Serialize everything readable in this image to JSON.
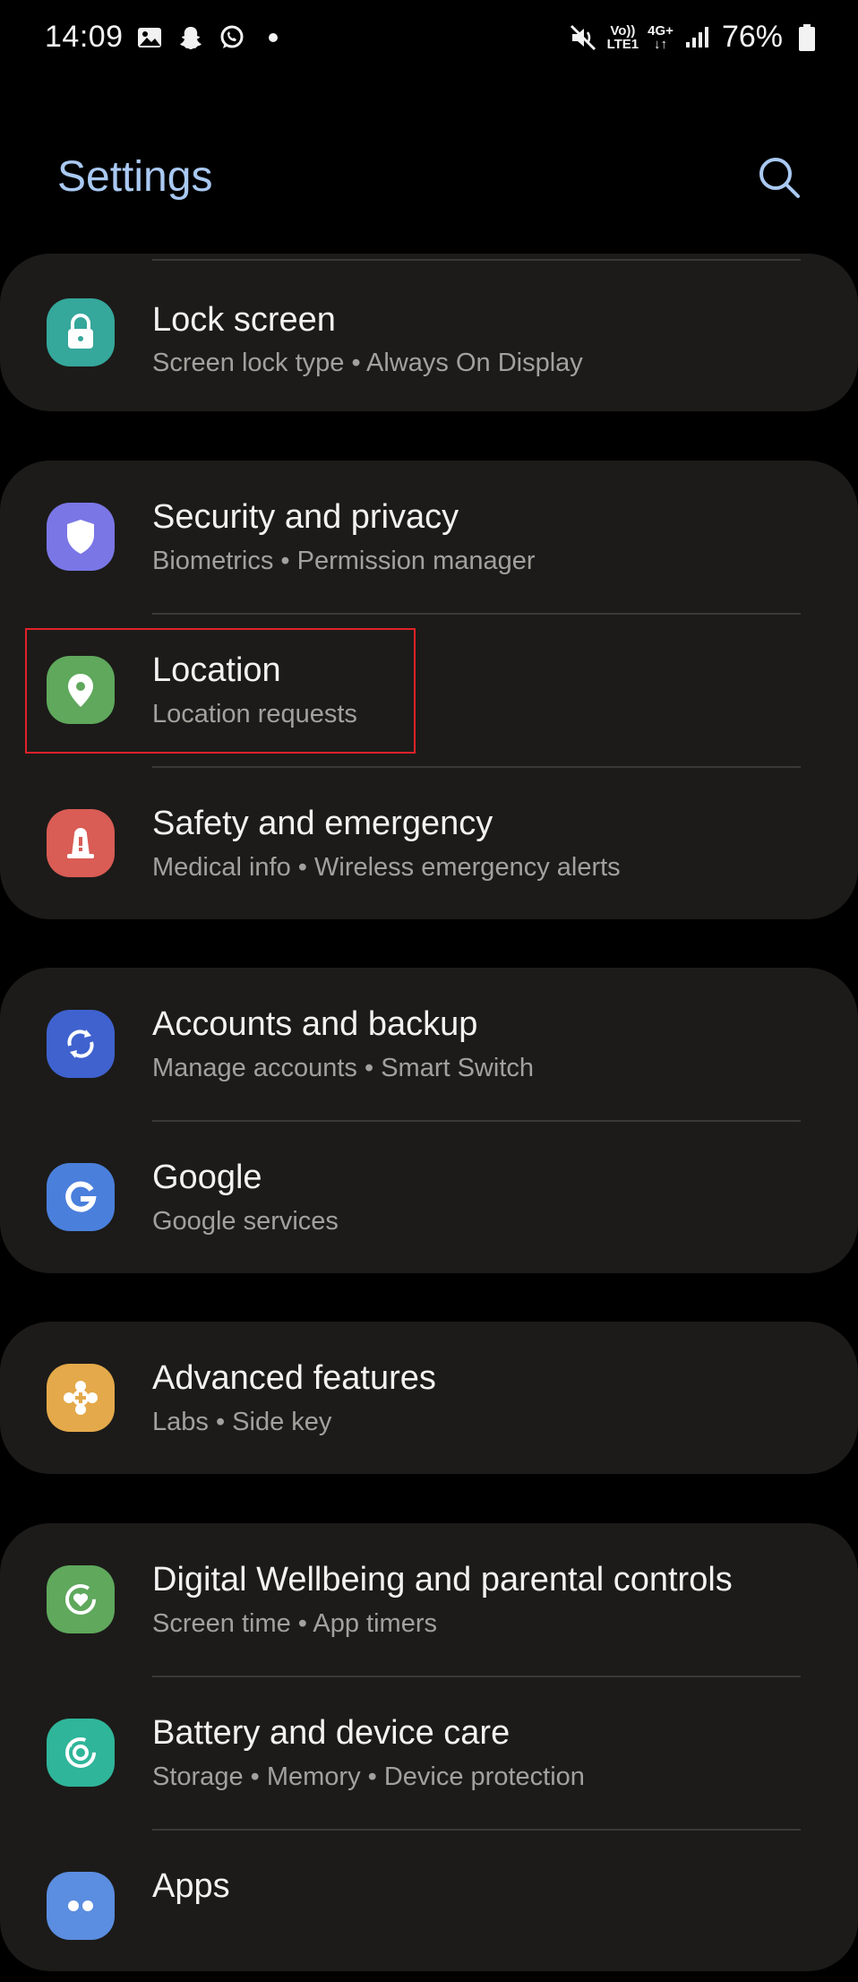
{
  "status_bar": {
    "time": "14:09",
    "notification_icons": [
      "gallery-icon",
      "snapchat-icon",
      "whatsapp-icon",
      "dot-icon"
    ],
    "system_icons": [
      "mute-icon",
      "volte-icon",
      "data-4g-icon",
      "signal-icon",
      "battery-icon"
    ],
    "volte_top": "Vo))",
    "volte_bottom": "LTE1",
    "net_type": "4G+",
    "battery_percent": "76%"
  },
  "header": {
    "title": "Settings",
    "search_icon": "search-icon"
  },
  "items": [
    {
      "title": "Lock screen",
      "subtitle": "Screen lock type  •  Always On Display",
      "icon": "lock-icon",
      "color": "#35a79b"
    },
    {
      "title": "Security and privacy",
      "subtitle": "Biometrics  •  Permission manager",
      "icon": "shield-icon",
      "color": "#7a76e6"
    },
    {
      "title": "Location",
      "subtitle": "Location requests",
      "icon": "location-pin-icon",
      "color": "#5fa85c"
    },
    {
      "title": "Safety and emergency",
      "subtitle": "Medical info  •  Wireless emergency alerts",
      "icon": "emergency-icon",
      "color": "#d95c55"
    },
    {
      "title": "Accounts and backup",
      "subtitle": "Manage accounts  •  Smart Switch",
      "icon": "sync-icon",
      "color": "#3f62cf"
    },
    {
      "title": "Google",
      "subtitle": "Google services",
      "icon": "google-icon",
      "color": "#4a7fdc"
    },
    {
      "title": "Advanced features",
      "subtitle": "Labs  •  Side key",
      "icon": "puzzle-icon",
      "color": "#e4a94a"
    },
    {
      "title": "Digital Wellbeing and parental controls",
      "subtitle": "Screen time  •  App timers",
      "icon": "wellbeing-icon",
      "color": "#5fa85c"
    },
    {
      "title": "Battery and device care",
      "subtitle": "Storage  •  Memory  •  Device protection",
      "icon": "device-care-icon",
      "color": "#2fb59a"
    },
    {
      "title": "Apps",
      "subtitle": "",
      "icon": "apps-icon",
      "color": "#5b8de0"
    }
  ]
}
